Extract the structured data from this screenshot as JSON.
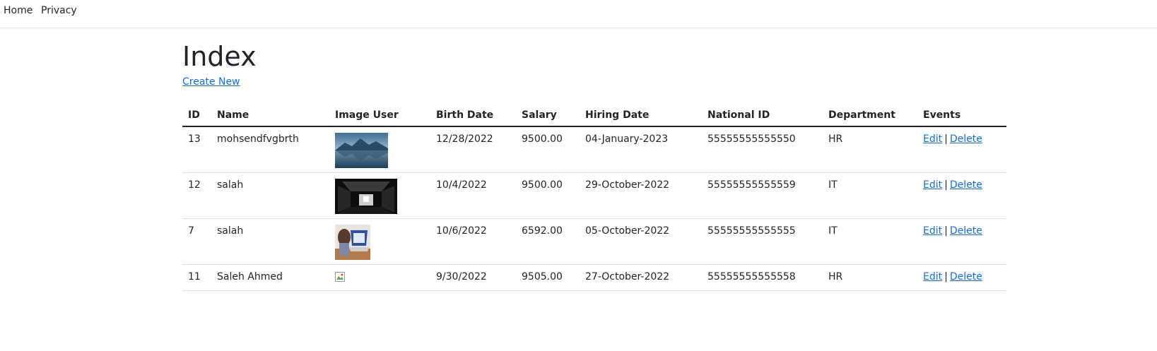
{
  "nav": {
    "home": "Home",
    "privacy": "Privacy"
  },
  "page": {
    "title": "Index",
    "create_new": "Create New"
  },
  "table": {
    "headers": [
      "ID",
      "Name",
      "Image User",
      "Birth Date",
      "Salary",
      "Hiring Date",
      "National ID",
      "Department",
      "Events"
    ],
    "rows": [
      {
        "id": "13",
        "name": "mohsendfvgbrth",
        "image": "mountain-lake-photo",
        "birth": "12/28/2022",
        "salary": "9500.00",
        "hiring": "04-January-2023",
        "national_id": "55555555555550",
        "department": "HR"
      },
      {
        "id": "12",
        "name": "salah",
        "image": "dark-room-photo",
        "birth": "10/4/2022",
        "salary": "9500.00",
        "hiring": "29-October-2022",
        "national_id": "55555555555559",
        "department": "IT"
      },
      {
        "id": "7",
        "name": "salah",
        "image": "person-laptop-photo",
        "birth": "10/6/2022",
        "salary": "6592.00",
        "hiring": "05-October-2022",
        "national_id": "55555555555555",
        "department": "IT"
      },
      {
        "id": "11",
        "name": "Saleh Ahmed",
        "image": "broken-image-icon",
        "birth": "9/30/2022",
        "salary": "9505.00",
        "hiring": "27-October-2022",
        "national_id": "55555555555558",
        "department": "HR"
      }
    ],
    "edit_label": "Edit",
    "delete_label": "Delete",
    "separator": "|"
  }
}
